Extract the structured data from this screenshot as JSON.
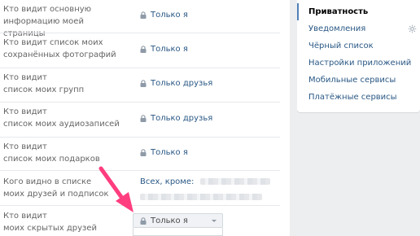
{
  "privacy_rows": [
    {
      "label_l1": "Кто видит основную",
      "label_l2": "информацию моей страницы",
      "value": "Только я"
    },
    {
      "label_l1": "Кто видит список моих",
      "label_l2": "сохранённых фотографий",
      "value": "Только я"
    },
    {
      "label_l1": "Кто видит",
      "label_l2": "список моих групп",
      "value": "Только друзья"
    },
    {
      "label_l1": "Кто видит",
      "label_l2": "список моих аудиозаписей",
      "value": "Только друзья"
    },
    {
      "label_l1": "Кто видит",
      "label_l2": "список моих подарков",
      "value": "Только я"
    },
    {
      "label_l1": "Кого видно в списке",
      "label_l2": "моих друзей и подписок",
      "value": "Всех, кроме:"
    },
    {
      "label_l1": "Кто видит",
      "label_l2": "моих скрытых друзей",
      "value": "Только я"
    }
  ],
  "sidebar_menu": [
    {
      "label": "Приватность",
      "active": true
    },
    {
      "label": "Уведомления",
      "active": false
    },
    {
      "label": "Чёрный список",
      "active": false
    },
    {
      "label": "Настройки приложений",
      "active": false
    },
    {
      "label": "Мобильные сервисы",
      "active": false
    },
    {
      "label": "Платёжные сервисы",
      "active": false
    }
  ],
  "icons": {
    "lock": "lock-icon",
    "gear": "gear-icon",
    "caret": "chevron-down-icon",
    "arrow": "pointer-arrow-icon"
  },
  "colors": {
    "link": "#2a5885",
    "accent": "#5181b8",
    "arrow": "#ff3d7f",
    "background": "#edeef0"
  }
}
